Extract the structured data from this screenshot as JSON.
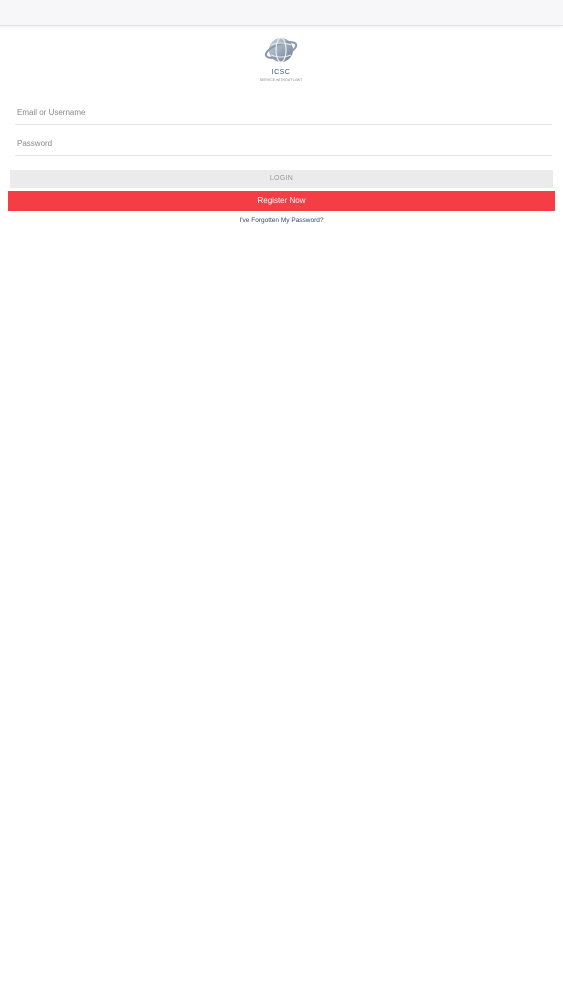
{
  "brand": {
    "logo_text": "ICSC",
    "logo_tagline": "SERVICE WITHOUT LIMIT"
  },
  "form": {
    "email_placeholder": "Email or Username",
    "password_placeholder": "Password",
    "login_label": "LOGIN",
    "register_label": "Register Now",
    "forgot_label": "I've Forgotten My Password?"
  },
  "colors": {
    "register_bg": "#f43d45",
    "login_bg": "#ebebeb",
    "link": "#2f4a6e",
    "top_bar": "#f7f6f9"
  }
}
